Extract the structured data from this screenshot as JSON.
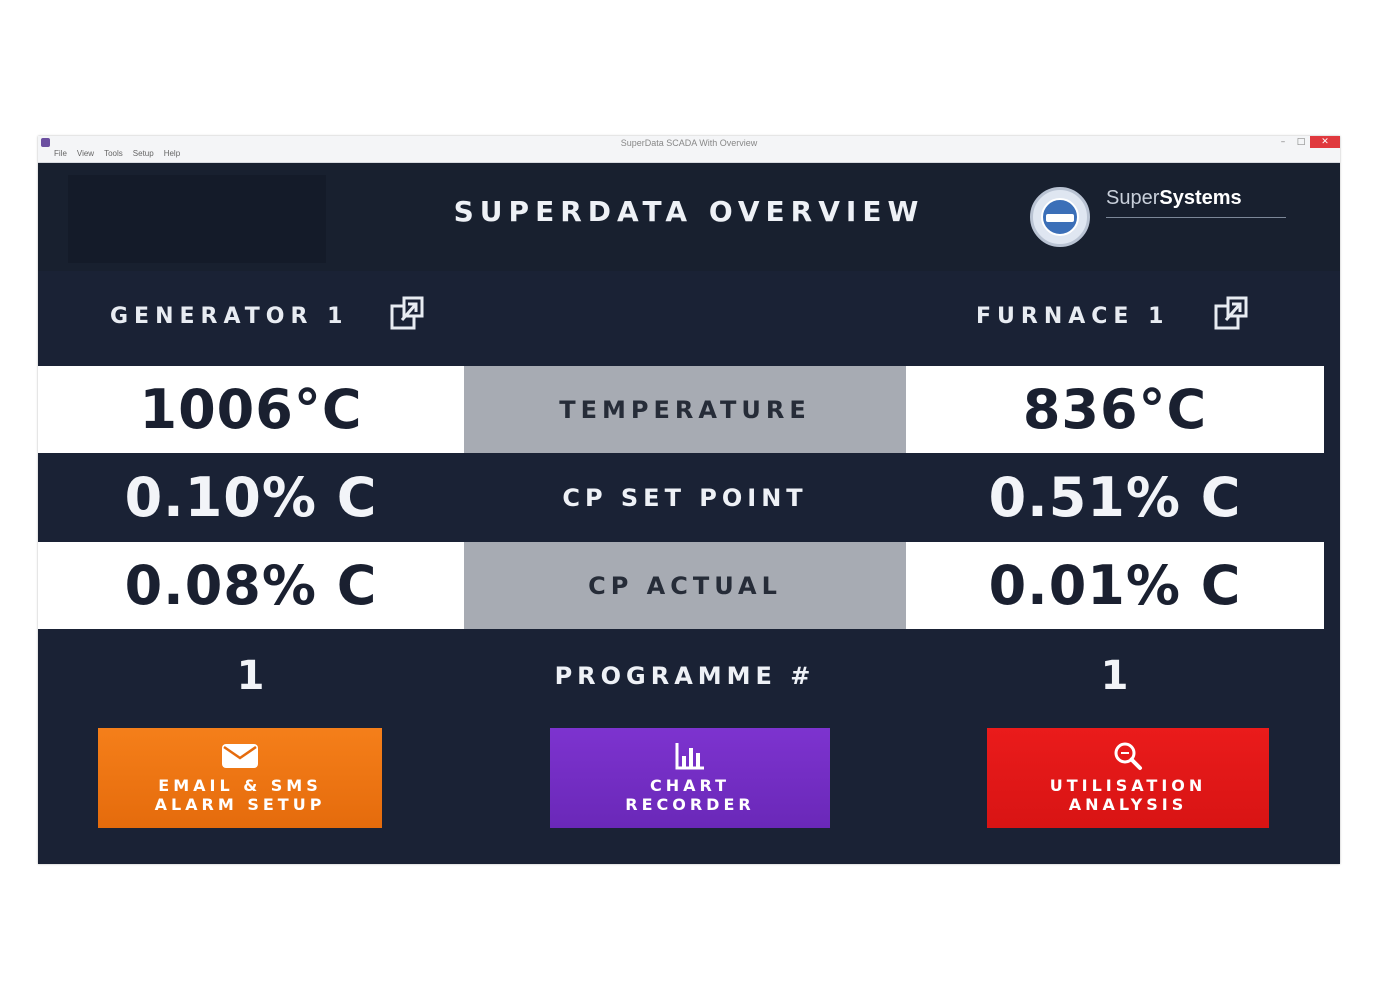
{
  "window": {
    "title": "SuperData SCADA With Overview",
    "menu": [
      "File",
      "View",
      "Tools",
      "Setup",
      "Help"
    ],
    "controls": {
      "minimize": "–",
      "maximize": "□",
      "close": "✕"
    }
  },
  "header": {
    "title": "SUPERDATA OVERVIEW",
    "logo": {
      "text_light": "Super",
      "text_bold": "Systems"
    }
  },
  "devices": {
    "left": {
      "name": "GENERATOR 1",
      "popout_icon": "popout-icon"
    },
    "right": {
      "name": "FURNACE 1",
      "popout_icon": "popout-icon"
    }
  },
  "rows": [
    {
      "label": "TEMPERATURE",
      "left": "1006°C",
      "right": "836°C"
    },
    {
      "label": "CP SET POINT",
      "left": "0.10% C",
      "right": "0.51% C"
    },
    {
      "label": "CP ACTUAL",
      "left": "0.08% C",
      "right": "0.01% C"
    },
    {
      "label": "PROGRAMME #",
      "left": "1",
      "right": "1"
    }
  ],
  "buttons": {
    "email": {
      "line1": "EMAIL & SMS",
      "line2": "ALARM SETUP",
      "icon": "envelope-icon",
      "color": "#f57f1a"
    },
    "chart": {
      "line1": "CHART",
      "line2": "RECORDER",
      "icon": "bar-chart-icon",
      "color": "#7d33cf"
    },
    "util": {
      "line1": "UTILISATION",
      "line2": "ANALYSIS",
      "icon": "magnifier-icon",
      "color": "#ea1b1b"
    }
  },
  "colors": {
    "background": "#1a2235",
    "header": "#18202f",
    "label_band": "#a7abb3"
  }
}
